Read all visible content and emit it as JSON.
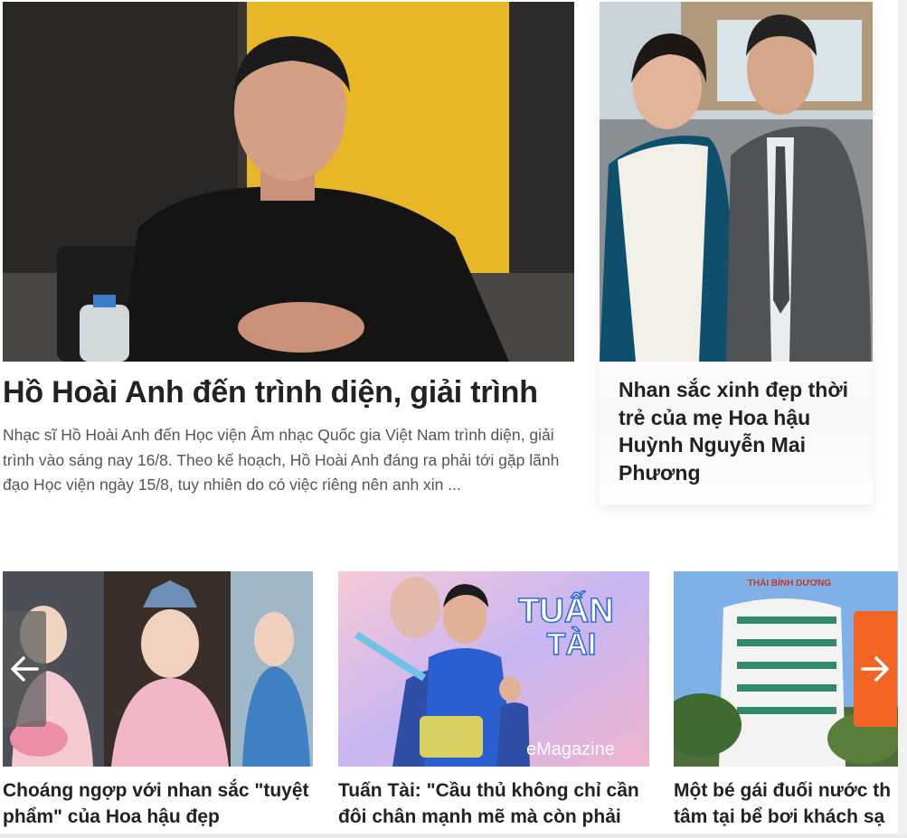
{
  "hero": {
    "title": "Hồ Hoài Anh đến trình diện, giải trình",
    "summary": "Nhạc sĩ Hồ Hoài Anh đến Học viện Âm nhạc Quốc gia Việt Nam trình diện, giải trình vào sáng nay 16/8. Theo kế hoạch, Hồ Hoài Anh đáng ra phải tới gặp lãnh đạo Học viện ngày 15/8, tuy nhiên do có việc riêng nên anh xin ..."
  },
  "side": {
    "title": "Nhan sắc xinh đẹp thời trẻ của mẹ Hoa hậu Huỳnh Nguyễn Mai Phương"
  },
  "carousel": {
    "items": [
      {
        "title": "Choáng ngợp với nhan sắc \"tuyệt phẩm\" của Hoa hậu đẹp"
      },
      {
        "title": "Tuấn Tài: \"Cầu thủ không chỉ cần đôi chân mạnh mẽ mà còn phải"
      },
      {
        "title_line1": "Một bé gái đuối nước th",
        "title_line2": "tâm tại bể bơi khách sạ"
      }
    ],
    "thumb2_overlay": {
      "badge_line1": "TUẤN",
      "badge_line2": "TÀI",
      "emag": "eMagazine"
    },
    "thumb3_sign": "THÁI BÌNH DƯƠNG",
    "prev_icon": "arrow-left-icon",
    "next_icon": "arrow-right-icon"
  },
  "colors": {
    "accent": "#f26522",
    "title": "#222222",
    "summary": "#555555"
  }
}
